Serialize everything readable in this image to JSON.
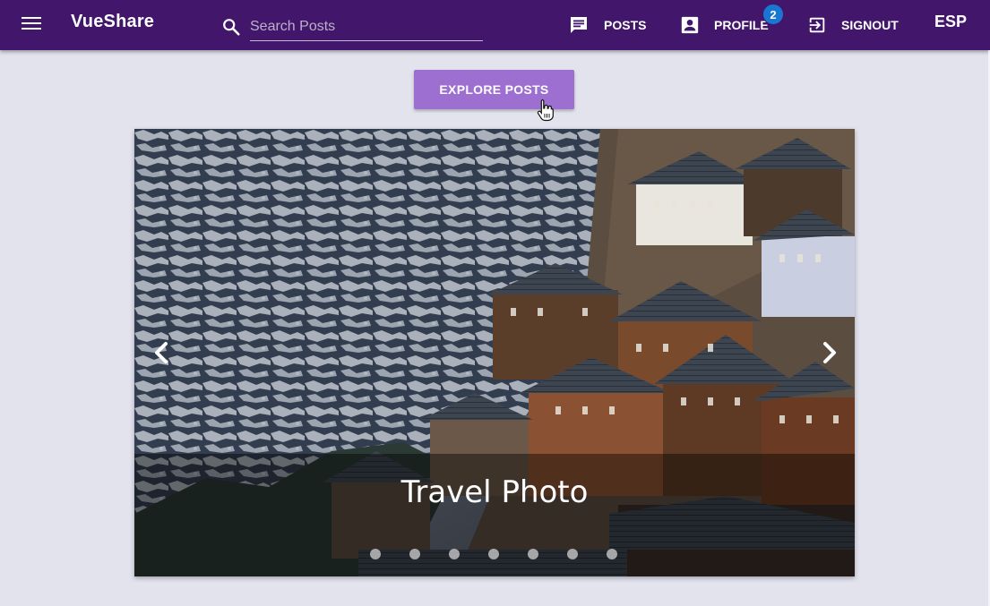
{
  "app": {
    "title": "VueShare"
  },
  "search": {
    "placeholder": "Search Posts"
  },
  "nav": {
    "posts_label": "POSTS",
    "profile_label": "PROFILE",
    "profile_badge": "2",
    "signout_label": "SIGNOUT",
    "language_label": "ESP"
  },
  "main": {
    "explore_label": "EXPLORE POSTS",
    "carousel": {
      "caption": "Travel Photo",
      "slide_count": 7,
      "active_slide": 1
    }
  },
  "colors": {
    "toolbar": "#42176b",
    "accent_button": "#9c6fd0",
    "badge": "#1976d2",
    "background": "#e3e3ee"
  },
  "icons": [
    "menu-icon",
    "search-icon",
    "posts-icon",
    "profile-icon",
    "signout-icon",
    "chevron-left-icon",
    "chevron-right-icon"
  ]
}
